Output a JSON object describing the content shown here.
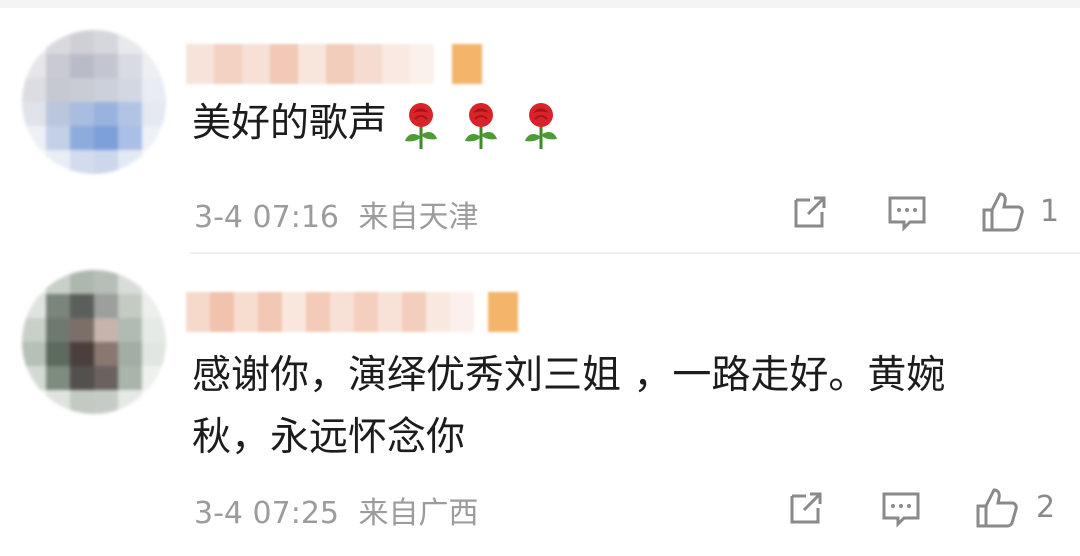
{
  "comments": [
    {
      "text": "美好的歌声",
      "emoji": "rose",
      "emoji_count": 3,
      "time": "3-4 07:16",
      "location": "来自天津",
      "likes": "1"
    },
    {
      "text_line1": "感谢你，演绎优秀刘三姐 ，一路走好。黄婉",
      "text_line2": "秋，永远怀念你",
      "time": "3-4 07:25",
      "location": "来自广西",
      "likes": "2"
    }
  ],
  "colors": {
    "meta_text": "#9c9c9c",
    "body_text": "#1c1c1c",
    "icon": "#8a8a8a",
    "divider": "#efefef"
  },
  "icons": [
    "share-icon",
    "comment-icon",
    "like-icon",
    "rose-emoji-icon"
  ]
}
